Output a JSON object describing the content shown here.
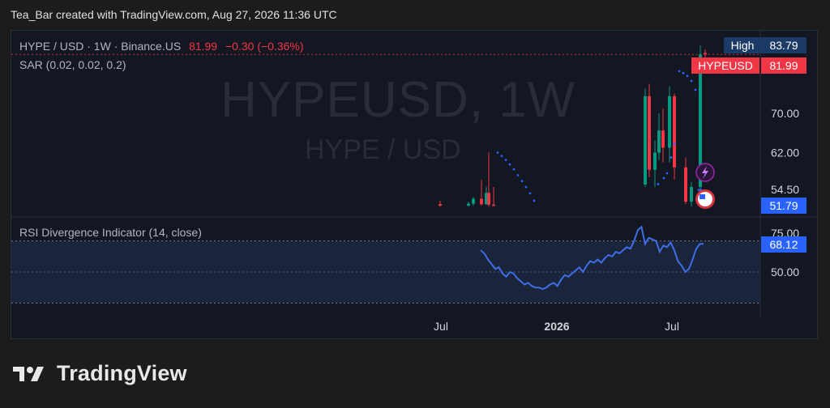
{
  "header": {
    "text": "Tea_Bar created with TradingView.com, Aug 27, 2026 11:36 UTC"
  },
  "legend": {
    "symbol": "HYPE / USD · 1W · Binance.US",
    "price": "81.99",
    "change": "−0.30 (−0.36%)",
    "sar": "SAR (0.02, 0.02, 0.2)",
    "rsi": "RSI Divergence Indicator (14, close)"
  },
  "watermark": {
    "symbol": "HYPEUSD, 1W",
    "pair": "HYPE / USD"
  },
  "tags": {
    "high_label": "High",
    "high_value": "83.79",
    "symbol_label": "HYPEUSD",
    "symbol_value": "81.99",
    "sar_value": "51.79",
    "rsi_value": "68.12"
  },
  "colors": {
    "up": "#089981",
    "down": "#f23645",
    "sar": "#2962ff",
    "rsi": "#3d6ee8",
    "high": "#1c3a66",
    "tag": "#2962ff"
  },
  "chart_data": [
    {
      "type": "candlestick",
      "title": "HYPE / USD · 1W · Binance.US",
      "x_ticks": [
        "Jul",
        "2026",
        "Jul"
      ],
      "y_ticks": [
        54.5,
        62.0,
        70.0
      ],
      "ylim": [
        51,
        84
      ],
      "candles": [
        {
          "o": 51.5,
          "h": 52.2,
          "l": 51.0,
          "c": 51.2
        },
        {
          "o": 51.2,
          "h": 52.0,
          "l": 51.0,
          "c": 51.6
        },
        {
          "o": 51.6,
          "h": 53.0,
          "l": 51.2,
          "c": 52.6
        },
        {
          "o": 52.6,
          "h": 56.5,
          "l": 51.2,
          "c": 51.5
        },
        {
          "o": 51.5,
          "h": 55.0,
          "l": 51.3,
          "c": 53.8
        },
        {
          "o": 53.8,
          "h": 62.0,
          "l": 51.0,
          "c": 51.4
        },
        {
          "o": 51.4,
          "h": 55.0,
          "l": 51.1,
          "c": 51.3
        },
        {
          "o": 55.5,
          "h": 75.0,
          "l": 55.0,
          "c": 73.5
        },
        {
          "o": 73.5,
          "h": 76.0,
          "l": 57.0,
          "c": 58.5
        },
        {
          "o": 58.5,
          "h": 64.5,
          "l": 55.0,
          "c": 62.0
        },
        {
          "o": 62.0,
          "h": 70.0,
          "l": 60.5,
          "c": 66.5
        },
        {
          "o": 66.5,
          "h": 71.0,
          "l": 60.0,
          "c": 63.0
        },
        {
          "o": 63.0,
          "h": 75.5,
          "l": 60.0,
          "c": 73.5
        },
        {
          "o": 73.5,
          "h": 74.0,
          "l": 56.5,
          "c": 59.0
        },
        {
          "o": 59.0,
          "h": 61.0,
          "l": 51.5,
          "c": 52.0
        },
        {
          "o": 52.0,
          "h": 56.0,
          "l": 51.0,
          "c": 55.0
        },
        {
          "o": 55.0,
          "h": 83.79,
          "l": 53.5,
          "c": 81.99
        },
        {
          "o": 82.3,
          "h": 83.0,
          "l": 80.5,
          "c": 81.99
        }
      ],
      "sar": [
        [
          0,
          62.0
        ],
        [
          1,
          61.3
        ],
        [
          2,
          60.5
        ],
        [
          3,
          59.6
        ],
        [
          4,
          58.6
        ],
        [
          5,
          57.4
        ],
        [
          6,
          56.2
        ],
        [
          7,
          55.0
        ],
        [
          8,
          53.7
        ],
        [
          9,
          52.2
        ],
        [
          10,
          55.6
        ],
        [
          11,
          56.8
        ],
        [
          12,
          57.8
        ],
        [
          13,
          61.0
        ],
        [
          14,
          63.8
        ],
        [
          15,
          54.4
        ],
        [
          16,
          54.4
        ],
        [
          17,
          78.6
        ],
        [
          18,
          78.2
        ],
        [
          19,
          77.6
        ],
        [
          20,
          76.6
        ],
        [
          21,
          74.8
        ]
      ]
    },
    {
      "type": "line",
      "title": "RSI Divergence Indicator (14, close)",
      "y_ticks": [
        50.0,
        75.0
      ],
      "ylim": [
        39,
        82
      ],
      "last_value": 68.12,
      "series": [
        {
          "values": [
            64,
            62,
            58,
            55,
            52,
            53,
            49,
            47,
            50,
            49,
            46,
            44,
            42,
            43,
            41,
            40,
            40,
            39,
            40,
            42,
            43,
            41,
            45,
            48,
            47,
            49,
            51,
            53,
            50,
            54,
            57,
            56,
            58,
            56,
            59,
            61,
            60,
            63,
            62,
            64,
            66,
            65,
            70,
            77,
            79,
            68,
            72,
            71,
            70,
            63,
            67,
            66,
            69,
            64,
            57,
            54,
            50,
            52,
            58,
            65,
            68,
            68.12
          ]
        }
      ]
    }
  ]
}
